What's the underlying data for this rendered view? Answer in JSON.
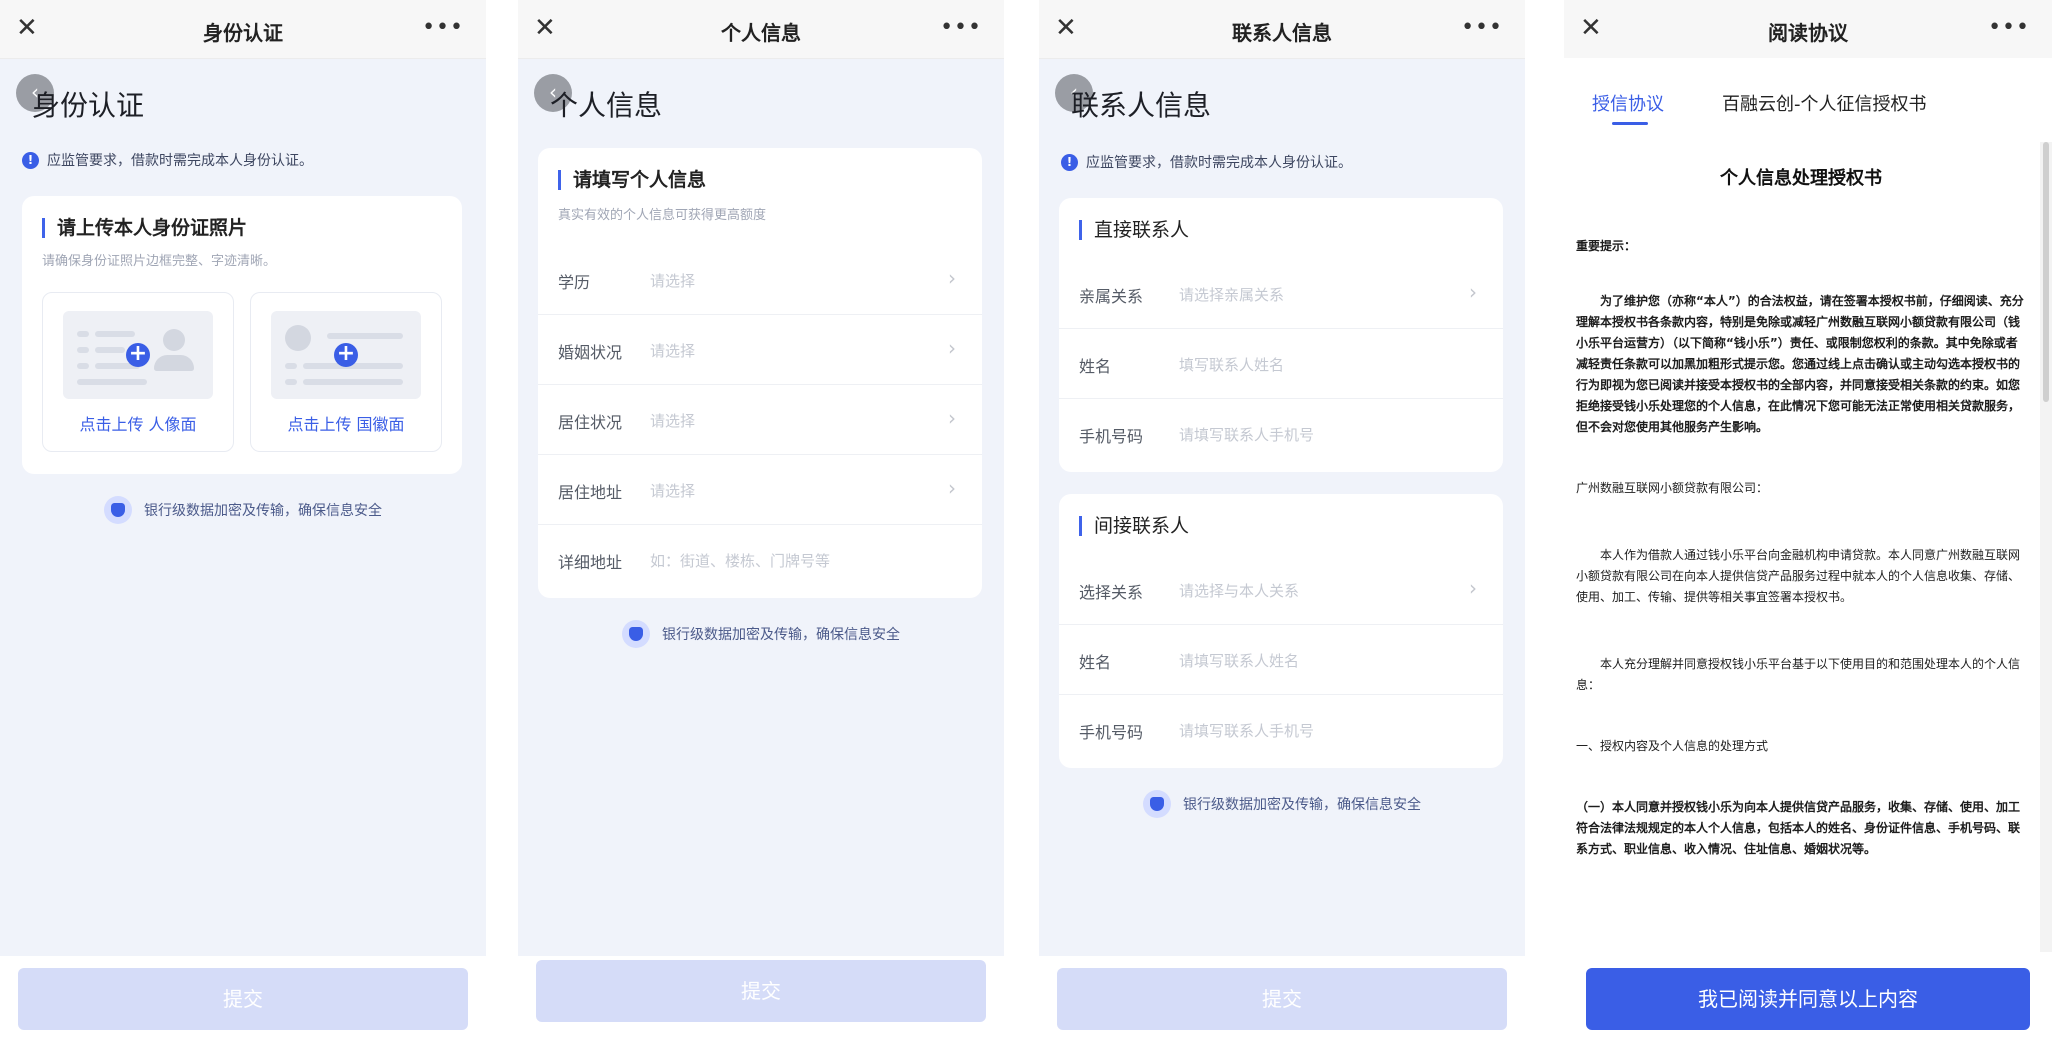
{
  "screens": [
    {
      "nav_title": "身份认证",
      "heading": "身份认证",
      "notice": "应监管要求，借款时需完成本人身份认证。",
      "card_title": "请上传本人身份证照片",
      "card_sub": "请确保身份证照片边框完整、字迹清晰。",
      "upload_front": "点击上传 人像面",
      "upload_back": "点击上传 国徽面",
      "security": "银行级数据加密及传输，确保信息安全",
      "submit": "提交"
    },
    {
      "nav_title": "个人信息",
      "heading": "个人信息",
      "card_title": "请填写个人信息",
      "card_sub": "真实有效的个人信息可获得更高额度",
      "rows": [
        {
          "label": "学历",
          "placeholder": "请选择"
        },
        {
          "label": "婚姻状况",
          "placeholder": "请选择"
        },
        {
          "label": "居住状况",
          "placeholder": "请选择"
        },
        {
          "label": "居住地址",
          "placeholder": "请选择"
        },
        {
          "label": "详细地址",
          "placeholder": "如：街道、楼栋、门牌号等"
        }
      ],
      "security": "银行级数据加密及传输，确保信息安全",
      "submit": "提交"
    },
    {
      "nav_title": "联系人信息",
      "heading": "联系人信息",
      "notice": "应监管要求，借款时需完成本人身份认证。",
      "direct_title": "直接联系人",
      "direct_rows": [
        {
          "label": "亲属关系",
          "placeholder": "请选择亲属关系"
        },
        {
          "label": "姓名",
          "placeholder": "填写联系人姓名"
        },
        {
          "label": "手机号码",
          "placeholder": "请填写联系人手机号"
        }
      ],
      "indirect_title": "间接联系人",
      "indirect_rows": [
        {
          "label": "选择关系",
          "placeholder": "请选择与本人关系"
        },
        {
          "label": "姓名",
          "placeholder": "请填写联系人姓名"
        },
        {
          "label": "手机号码",
          "placeholder": "请填写联系人手机号"
        }
      ],
      "security": "银行级数据加密及传输，确保信息安全",
      "submit": "提交"
    },
    {
      "nav_title": "阅读协议",
      "tabs": [
        "授信协议",
        "百融云创-个人征信授权书"
      ],
      "doc_title": "个人信息处理授权书",
      "paragraphs": [
        "重要提示：",
        "为了维护您（亦称“本人”）的合法权益，请在签署本授权书前，仔细阅读、充分理解本授权书各条款内容，特别是免除或减轻广州数融互联网小额贷款有限公司（钱小乐平台运营方）（以下简称“钱小乐”）责任、或限制您权利的条款。其中免除或者减轻责任条款可以加黑加粗形式提示您。您通过线上点击确认或主动勾选本授权书的行为即视为您已阅读并接受本授权书的全部内容，并同意接受相关条款的约束。如您拒绝接受钱小乐处理您的个人信息，在此情况下您可能无法正常使用相关贷款服务，但不会对您使用其他服务产生影响。",
        "广州数融互联网小额贷款有限公司：",
        "本人作为借款人通过钱小乐平台向金融机构申请贷款。本人同意广州数融互联网小额贷款有限公司在向本人提供信贷产品服务过程中就本人的个人信息收集、存储、使用、加工、传输、提供等相关事宜签署本授权书。",
        "本人充分理解并同意授权钱小乐平台基于以下使用目的和范围处理本人的个人信息：",
        "一、授权内容及个人信息的处理方式",
        "（一）本人同意并授权钱小乐为向本人提供信贷产品服务，收集、存储、使用、加工符合法律法规规定的本人个人信息，包括本人的姓名、身份证件信息、手机号码、联系方式、职业信息、收入情况、住址信息、婚姻状况等。"
      ],
      "agree": "我已阅读并同意以上内容"
    }
  ],
  "colors": {
    "accent": "#3a5ee6",
    "disabled_button": "#d5dcf8",
    "background": "#f0f3fa"
  }
}
